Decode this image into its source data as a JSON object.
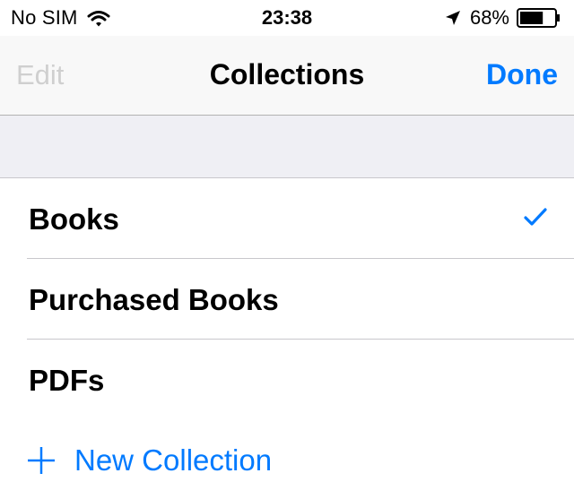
{
  "status_bar": {
    "carrier": "No SIM",
    "time": "23:38",
    "battery_percent": "68%",
    "battery_level": 0.68,
    "icons": [
      "wifi-icon",
      "location-arrow-icon",
      "battery-icon"
    ]
  },
  "nav": {
    "edit_label": "Edit",
    "title": "Collections",
    "done_label": "Done"
  },
  "collections": [
    {
      "label": "Books",
      "selected": true
    },
    {
      "label": "Purchased Books",
      "selected": false
    },
    {
      "label": "PDFs",
      "selected": false
    }
  ],
  "new_collection": {
    "label": "New Collection",
    "icon": "plus-icon"
  },
  "colors": {
    "accent": "#007aff",
    "disabled_text": "#cfcfcf",
    "section_background": "#efeff4",
    "separator": "#c8c7cc"
  }
}
